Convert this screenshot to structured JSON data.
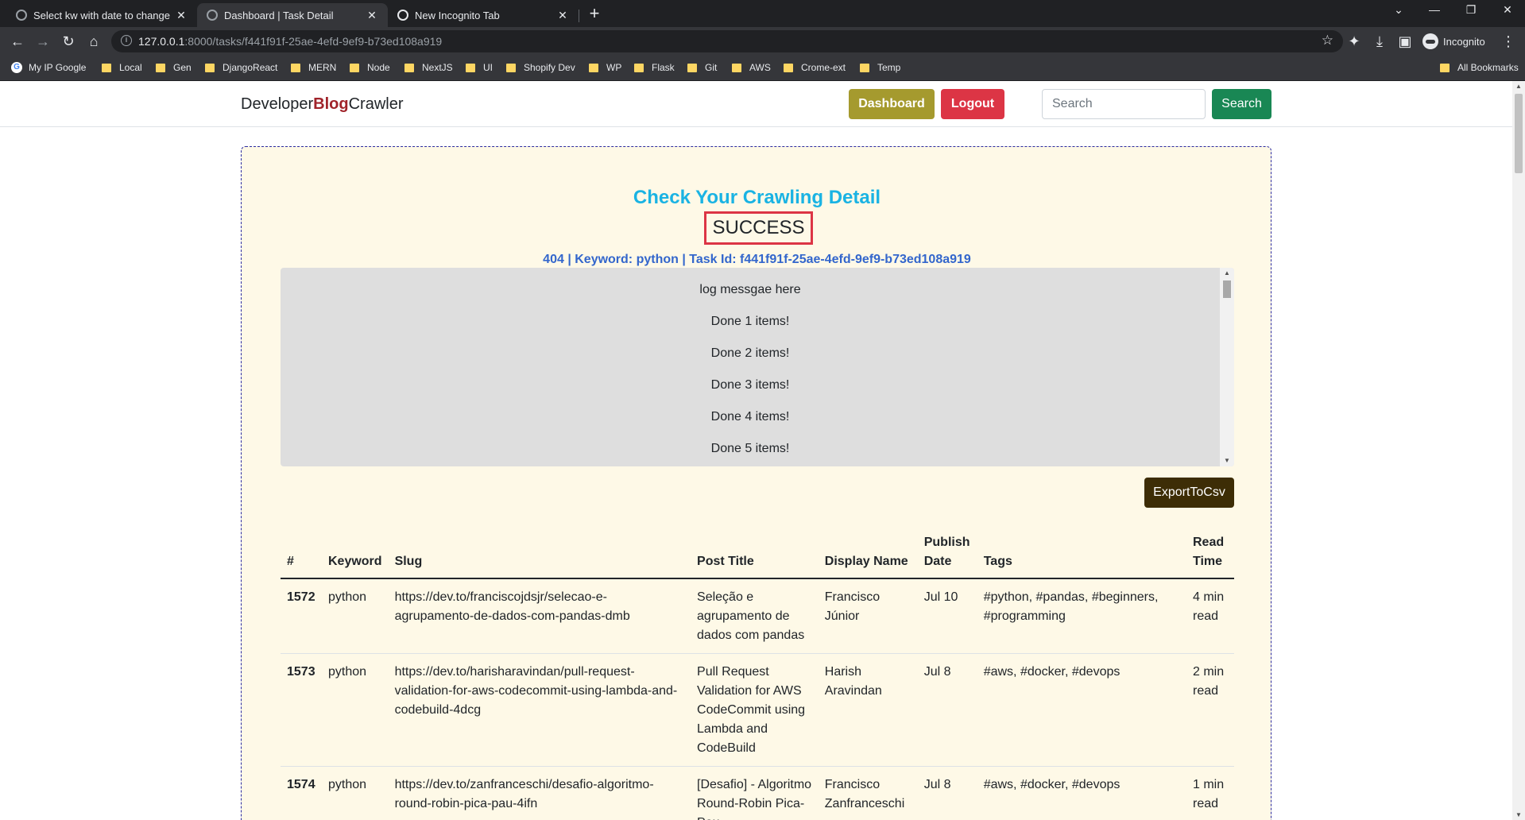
{
  "browser": {
    "tabs": [
      {
        "title": "Select kw with date to change | D"
      },
      {
        "title": "Dashboard | Task Detail"
      },
      {
        "title": "New Incognito Tab"
      }
    ],
    "new_tab": "+",
    "url_host": "127.0.0.1",
    "url_rest": ":8000/tasks/f441f91f-25ae-4efd-9ef9-b73ed108a919",
    "profile_label": "Incognito",
    "bookmarks": [
      "My IP Google",
      "Local",
      "Gen",
      "DjangoReact",
      "MERN",
      "Node",
      "NextJS",
      "UI",
      "Shopify Dev",
      "WP",
      "Flask",
      "Git",
      "AWS",
      "Crome-ext",
      "Temp"
    ],
    "all_bookmarks": "All Bookmarks",
    "window_controls": [
      "⌄",
      "—",
      "❐",
      "✕"
    ],
    "colors": {
      "chrome_dark": "#202124",
      "chrome_toolbar": "#35363a",
      "folder": "#fdd663"
    }
  },
  "navbar": {
    "brand_prefix": "Developer",
    "brand_highlight": "Blog",
    "brand_suffix": "Crawler",
    "dashboard_label": "Dashboard",
    "logout_label": "Logout",
    "search_placeholder": "Search",
    "search_button": "Search"
  },
  "detail": {
    "title": "Check Your Crawling Detail",
    "status": "SUCCESS",
    "subinfo": "404 | Keyword: python | Task Id: f441f91f-25ae-4efd-9ef9-b73ed108a919",
    "log_lines": [
      "log messgae here",
      "Done 1 items!",
      "Done 2 items!",
      "Done 3 items!",
      "Done 4 items!",
      "Done 5 items!"
    ],
    "export_label": "ExportToCsv"
  },
  "table": {
    "headers": [
      "#",
      "Keyword",
      "Slug",
      "Post Title",
      "Display Name",
      "Publish Date",
      "Tags",
      "Read Time"
    ],
    "rows": [
      {
        "num": "1572",
        "keyword": "python",
        "slug": "https://dev.to/franciscojdsjr/selecao-e-agrupamento-de-dados-com-pandas-dmb",
        "title": "Seleção e agrupamento de dados com pandas",
        "display_name": "Francisco Júnior",
        "date": "Jul 10",
        "tags": "#python, #pandas, #beginners, #programming",
        "read_time": "4 min read"
      },
      {
        "num": "1573",
        "keyword": "python",
        "slug": "https://dev.to/harisharavindan/pull-request-validation-for-aws-codecommit-using-lambda-and-codebuild-4dcg",
        "title": "Pull Request Validation for AWS CodeCommit using Lambda and CodeBuild",
        "display_name": "Harish Aravindan",
        "date": "Jul 8",
        "tags": "#aws, #docker, #devops",
        "read_time": "2 min read"
      },
      {
        "num": "1574",
        "keyword": "python",
        "slug": "https://dev.to/zanfranceschi/desafio-algoritmo-round-robin-pica-pau-4ifn",
        "title": "[Desafio] - Algoritmo Round-Robin Pica-Pau",
        "display_name": "Francisco Zanfranceschi",
        "date": "Jul 8",
        "tags": "#aws, #docker, #devops",
        "read_time": "1 min read"
      }
    ]
  },
  "colors": {
    "card_bg": "#fef9e7",
    "card_border": "#2a2aa0",
    "title": "#1ab3e3",
    "subinfo": "#3366cc",
    "dashboard_btn": "#a59a2e",
    "logout_btn": "#dc3545",
    "search_btn": "#198754",
    "export_btn": "#3d2d06",
    "brand_highlight": "#a0232a"
  }
}
